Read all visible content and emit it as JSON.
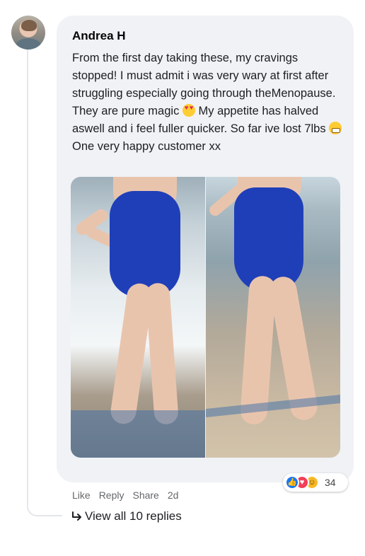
{
  "comment": {
    "author": "Andrea H",
    "text_part1": "From the first day taking these, my cravings stopped! I must admit i was very wary at first after struggling especially going through theMenopause. They are pure magic ",
    "text_part2": " My appetite has halved aswell and i feel fuller quicker. So far ive lost 7lbs ",
    "text_part3": " One very happy customer xx",
    "emoji_1": "heart-eyes-emoji",
    "emoji_2": "grinning-emoji"
  },
  "photos": [
    {
      "name": "before-photo"
    },
    {
      "name": "after-photo"
    }
  ],
  "reactions": {
    "icons": [
      "like-icon",
      "love-icon",
      "haha-icon"
    ],
    "count": "34"
  },
  "actions": {
    "like": "Like",
    "reply": "Reply",
    "share": "Share",
    "time": "2d"
  },
  "replies": {
    "label": "View all 10 replies"
  },
  "colors": {
    "bubble_bg": "#f0f2f5",
    "swimsuit": "#1f3fb8",
    "like_blue": "#1877f2",
    "love_red": "#f33e58",
    "haha_yellow": "#f7b928"
  }
}
